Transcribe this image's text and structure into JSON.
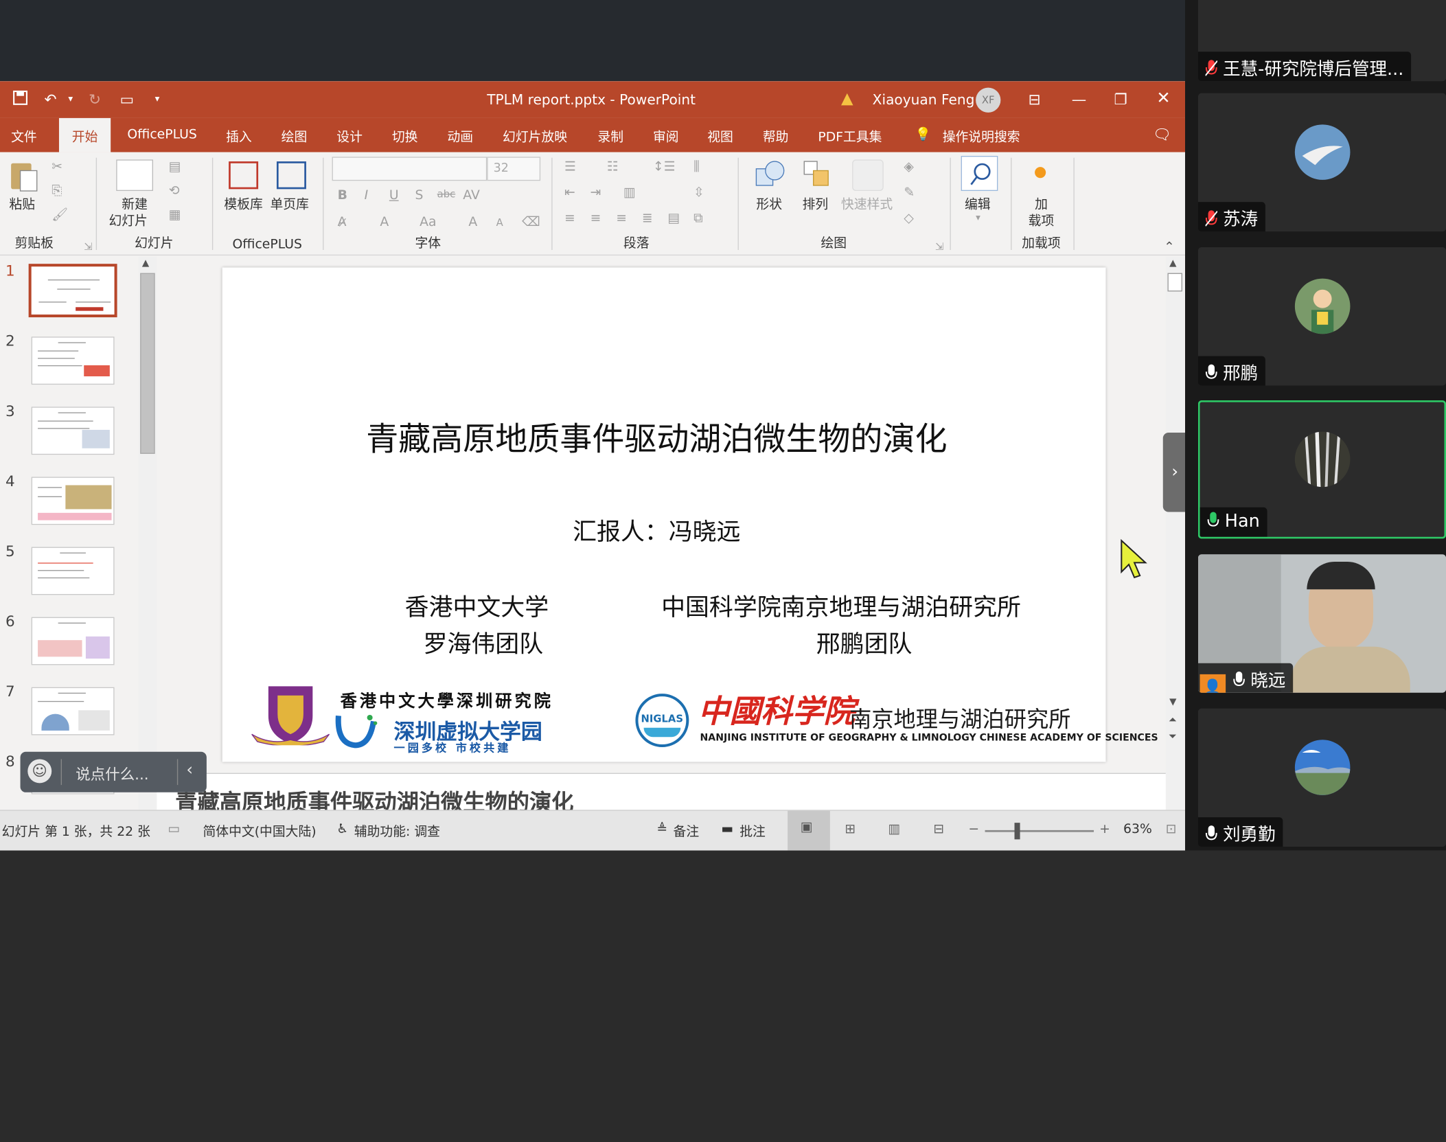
{
  "window": {
    "title": "TPLM report.pptx  -  PowerPoint",
    "user_name": "Xiaoyuan Feng",
    "user_initials": "XF"
  },
  "tabs": [
    "文件",
    "开始",
    "OfficePLUS",
    "插入",
    "绘图",
    "设计",
    "切换",
    "动画",
    "幻灯片放映",
    "录制",
    "审阅",
    "视图",
    "帮助",
    "PDF工具集",
    "操作说明搜索"
  ],
  "ribbon": {
    "paste": "粘贴",
    "new_slide_1": "新建",
    "new_slide_2": "幻灯片",
    "templates": "模板库",
    "single_page": "单页库",
    "font_size": "32",
    "shapes": "形状",
    "arrange": "排列",
    "quick_styles": "快速样式",
    "edit": "编辑",
    "addin_1": "加",
    "addin_2": "载项",
    "groups": {
      "clipboard": "剪贴板",
      "slides": "幻灯片",
      "officeplus": "OfficePLUS",
      "font": "字体",
      "paragraph": "段落",
      "drawing": "绘图",
      "addins": "加载项"
    }
  },
  "thumbnails": [
    "1",
    "2",
    "3",
    "4",
    "5",
    "6",
    "7",
    "8"
  ],
  "slide": {
    "title": "青藏高原地质事件驱动湖泊微生物的演化",
    "presenter": "汇报人：冯晓远",
    "left_org": "香港中文大学",
    "left_team": "罗海伟团队",
    "right_org": "中国科学院南京地理与湖泊研究所",
    "right_team": "邢鹏团队",
    "logo_cuhk_1": "香港中文大學深圳研究院",
    "logo_cuhk_2": "深圳虚拟大学园",
    "logo_cuhk_3": "一园多校  市校共建",
    "logo_cas_1": "中國科学院",
    "logo_cas_2": "南京地理与湖泊研究所",
    "logo_cas_3": "NANJING INSTITUTE OF GEOGRAPHY & LIMNOLOGY CHINESE ACADEMY OF SCIENCES",
    "logo_niglas": "NIGLAS"
  },
  "notes": "青藏高原地质事件驱动湖泊微生物的演化",
  "status": {
    "slide_pos": "幻灯片 第 1 张，共 22 张",
    "language": "简体中文(中国大陆)",
    "accessibility": "辅助功能: 调查",
    "notes": "备注",
    "comments": "批注",
    "zoom": "63%"
  },
  "chat": {
    "placeholder": "说点什么..."
  },
  "participants": [
    {
      "name": "王慧-研究院博后管理...",
      "muted": true
    },
    {
      "name": "苏涛",
      "muted": true
    },
    {
      "name": "邢鹏",
      "muted": false
    },
    {
      "name": "Han",
      "muted": false,
      "speaking": true
    },
    {
      "name": "晓远",
      "muted": false,
      "video": true
    },
    {
      "name": "刘勇勤",
      "muted": false
    }
  ],
  "colors": {
    "accent": "#b7472a",
    "speaking": "#2ec866",
    "muted": "#ff3b3b"
  }
}
